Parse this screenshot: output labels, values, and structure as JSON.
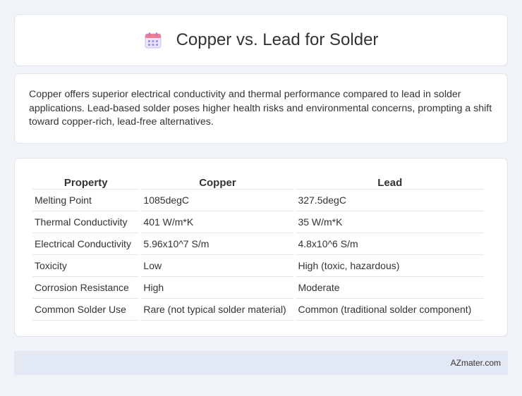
{
  "header": {
    "title": "Copper vs. Lead for Solder",
    "icon": "calendar-icon"
  },
  "intro": {
    "text": "Copper offers superior electrical conductivity and thermal performance compared to lead in solder applications. Lead-based solder poses higher health risks and environmental concerns, prompting a shift toward copper-rich, lead-free alternatives."
  },
  "table": {
    "headers": [
      "Property",
      "Copper",
      "Lead"
    ],
    "rows": [
      [
        "Melting Point",
        "1085degC",
        "327.5degC"
      ],
      [
        "Thermal Conductivity",
        "401 W/m*K",
        "35 W/m*K"
      ],
      [
        "Electrical Conductivity",
        "5.96x10^7 S/m",
        "4.8x10^6 S/m"
      ],
      [
        "Toxicity",
        "Low",
        "High (toxic, hazardous)"
      ],
      [
        "Corrosion Resistance",
        "High",
        "Moderate"
      ],
      [
        "Common Solder Use",
        "Rare (not typical solder material)",
        "Common (traditional solder component)"
      ]
    ]
  },
  "footer": {
    "text": "AZmater.com"
  }
}
